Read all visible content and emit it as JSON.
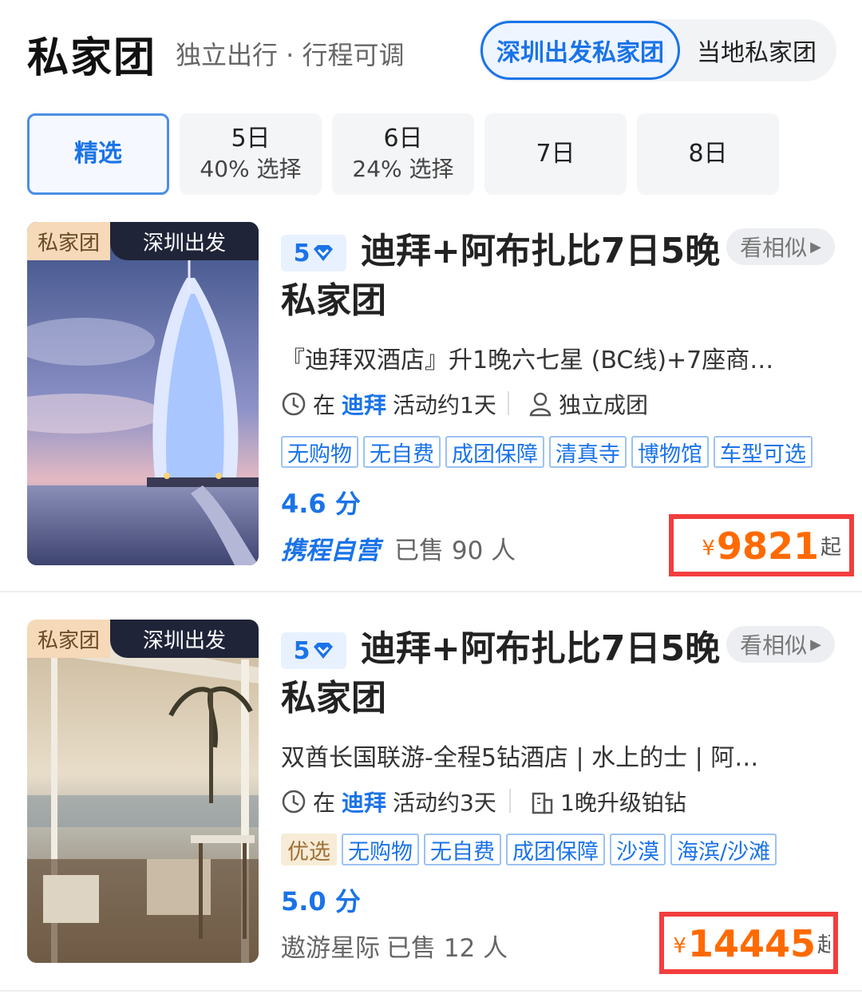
{
  "header": {
    "title": "私家团",
    "subtitle": "独立出行 · 行程可调",
    "seg_active": "深圳出发私家团",
    "seg_other": "当地私家团"
  },
  "tabs": [
    {
      "label": "精选",
      "sub": ""
    },
    {
      "label": "5日",
      "sub": "40% 选择"
    },
    {
      "label": "6日",
      "sub": "24% 选择"
    },
    {
      "label": "7日",
      "sub": ""
    },
    {
      "label": "8日",
      "sub": ""
    }
  ],
  "cards": [
    {
      "badge_left": "私家团",
      "badge_right": "深圳出发",
      "star": "5",
      "title": "迪拜+阿布扎比7日5晚私家团",
      "similar": "看相似",
      "desc": "『迪拜双酒店』升1晚六七星 (BC线)+7座商…",
      "meta1_prefix": "在",
      "meta1_hl": "迪拜",
      "meta1_suffix": "活动约1天",
      "meta2": "独立成团",
      "tags": [
        "无购物",
        "无自费",
        "成团保障",
        "清真寺",
        "博物馆",
        "车型可选"
      ],
      "score": "4.6 分",
      "brand": "携程自营",
      "sold": "已售 90 人",
      "currency": "¥",
      "price": "9821",
      "price_suffix": "起"
    },
    {
      "badge_left": "私家团",
      "badge_right": "深圳出发",
      "star": "5",
      "title": "迪拜+阿布扎比7日5晚私家团",
      "similar": "看相似",
      "desc": "双酋长国联游-全程5钻酒店 | 水上的士 | 阿…",
      "meta1_prefix": "在",
      "meta1_hl": "迪拜",
      "meta1_suffix": "活动约3天",
      "meta2": "1晚升级铂钻",
      "tag_gold": "优选",
      "tags": [
        "无购物",
        "无自费",
        "成团保障",
        "沙漠",
        "海滨/沙滩"
      ],
      "score": "5.0 分",
      "brand": "遨游星际",
      "sold": "已售 12 人",
      "currency": "¥",
      "price": "14445",
      "price_suffix": "起"
    }
  ],
  "colors": {
    "accent": "#1a73e8",
    "price": "#ff6a00",
    "highlight_border": "#f23d3d"
  }
}
